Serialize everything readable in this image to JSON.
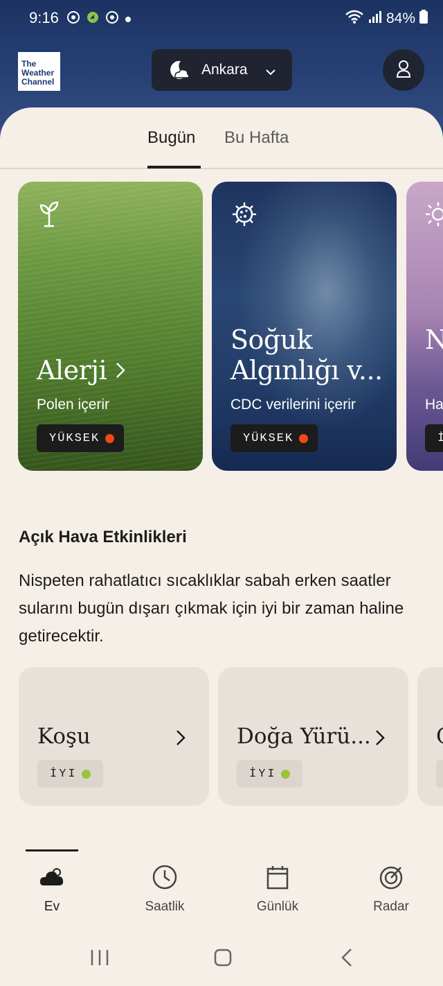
{
  "status_bar": {
    "time": "9:16",
    "battery": "84%"
  },
  "header": {
    "logo_text": "The Weather Channel",
    "location": "Ankara",
    "icons": [
      "moon-icon",
      "chevron-down-icon",
      "profile-icon"
    ]
  },
  "tabs": [
    {
      "label": "Bugün",
      "active": true
    },
    {
      "label": "Bu Hafta",
      "active": false
    }
  ],
  "health_cards": [
    {
      "title": "Alerji",
      "subtitle": "Polen içerir",
      "level": "YÜKSEK",
      "icon": "sprout-icon"
    },
    {
      "title_line1": "Soğuk",
      "title_line2": "Algınlığı v...",
      "subtitle": "CDC verilerini içerir",
      "level": "YÜKSEK",
      "icon": "virus-icon"
    },
    {
      "title": "N",
      "subtitle": "Ha",
      "level": "İ",
      "icon": "sun-icon"
    }
  ],
  "outdoor": {
    "title": "Açık Hava Etkinlikleri",
    "description": "Nispeten rahatlatıcı sıcaklıklar sabah erken saatler sularını bugün dışarı çıkmak için iyi bir zaman haline getirecektir.",
    "activities": [
      {
        "label": "Koşu",
        "rating": "İYI"
      },
      {
        "label": "Doğa Yürü...",
        "rating": "İYI"
      },
      {
        "label": "C",
        "rating": ""
      }
    ]
  },
  "bottom_nav": [
    {
      "label": "Ev",
      "icon": "cloud-icon",
      "active": true
    },
    {
      "label": "Saatlik",
      "icon": "clock-icon",
      "active": false
    },
    {
      "label": "Günlük",
      "icon": "calendar-icon",
      "active": false
    },
    {
      "label": "Radar",
      "icon": "radar-icon",
      "active": false
    }
  ],
  "colors": {
    "header_bg": "#1c3262",
    "sheet_bg": "#f5efe8",
    "high_level_dot": "#f04a16",
    "good_dot": "#9bc43a"
  }
}
